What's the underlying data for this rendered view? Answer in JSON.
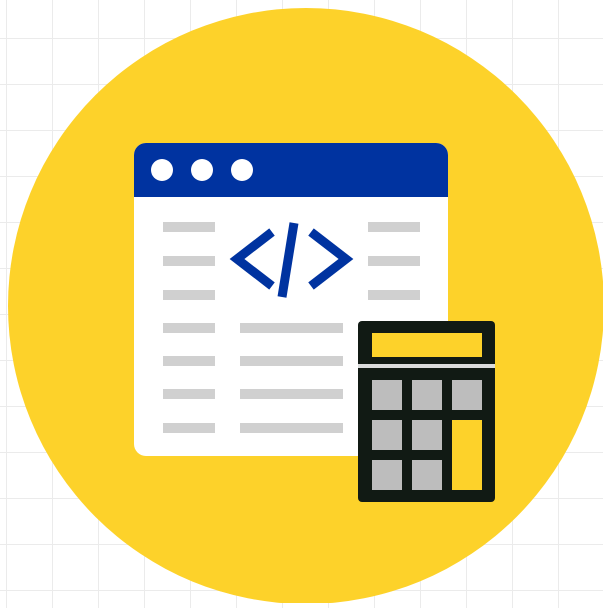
{
  "illustration": {
    "icon_name": "code-calculator-illustration",
    "code_symbol": "</>",
    "colors": {
      "circle": "#FDD22A",
      "browser_bar": "#0033A0",
      "browser_body": "#FFFFFF",
      "code_symbol": "#0033A0",
      "placeholder_lines": "#D0D0D0",
      "calculator_body": "#111A14",
      "calculator_display": "#FDD22A",
      "calculator_keys": "#BDBDBD",
      "calculator_equals_key": "#FDD22A"
    }
  }
}
